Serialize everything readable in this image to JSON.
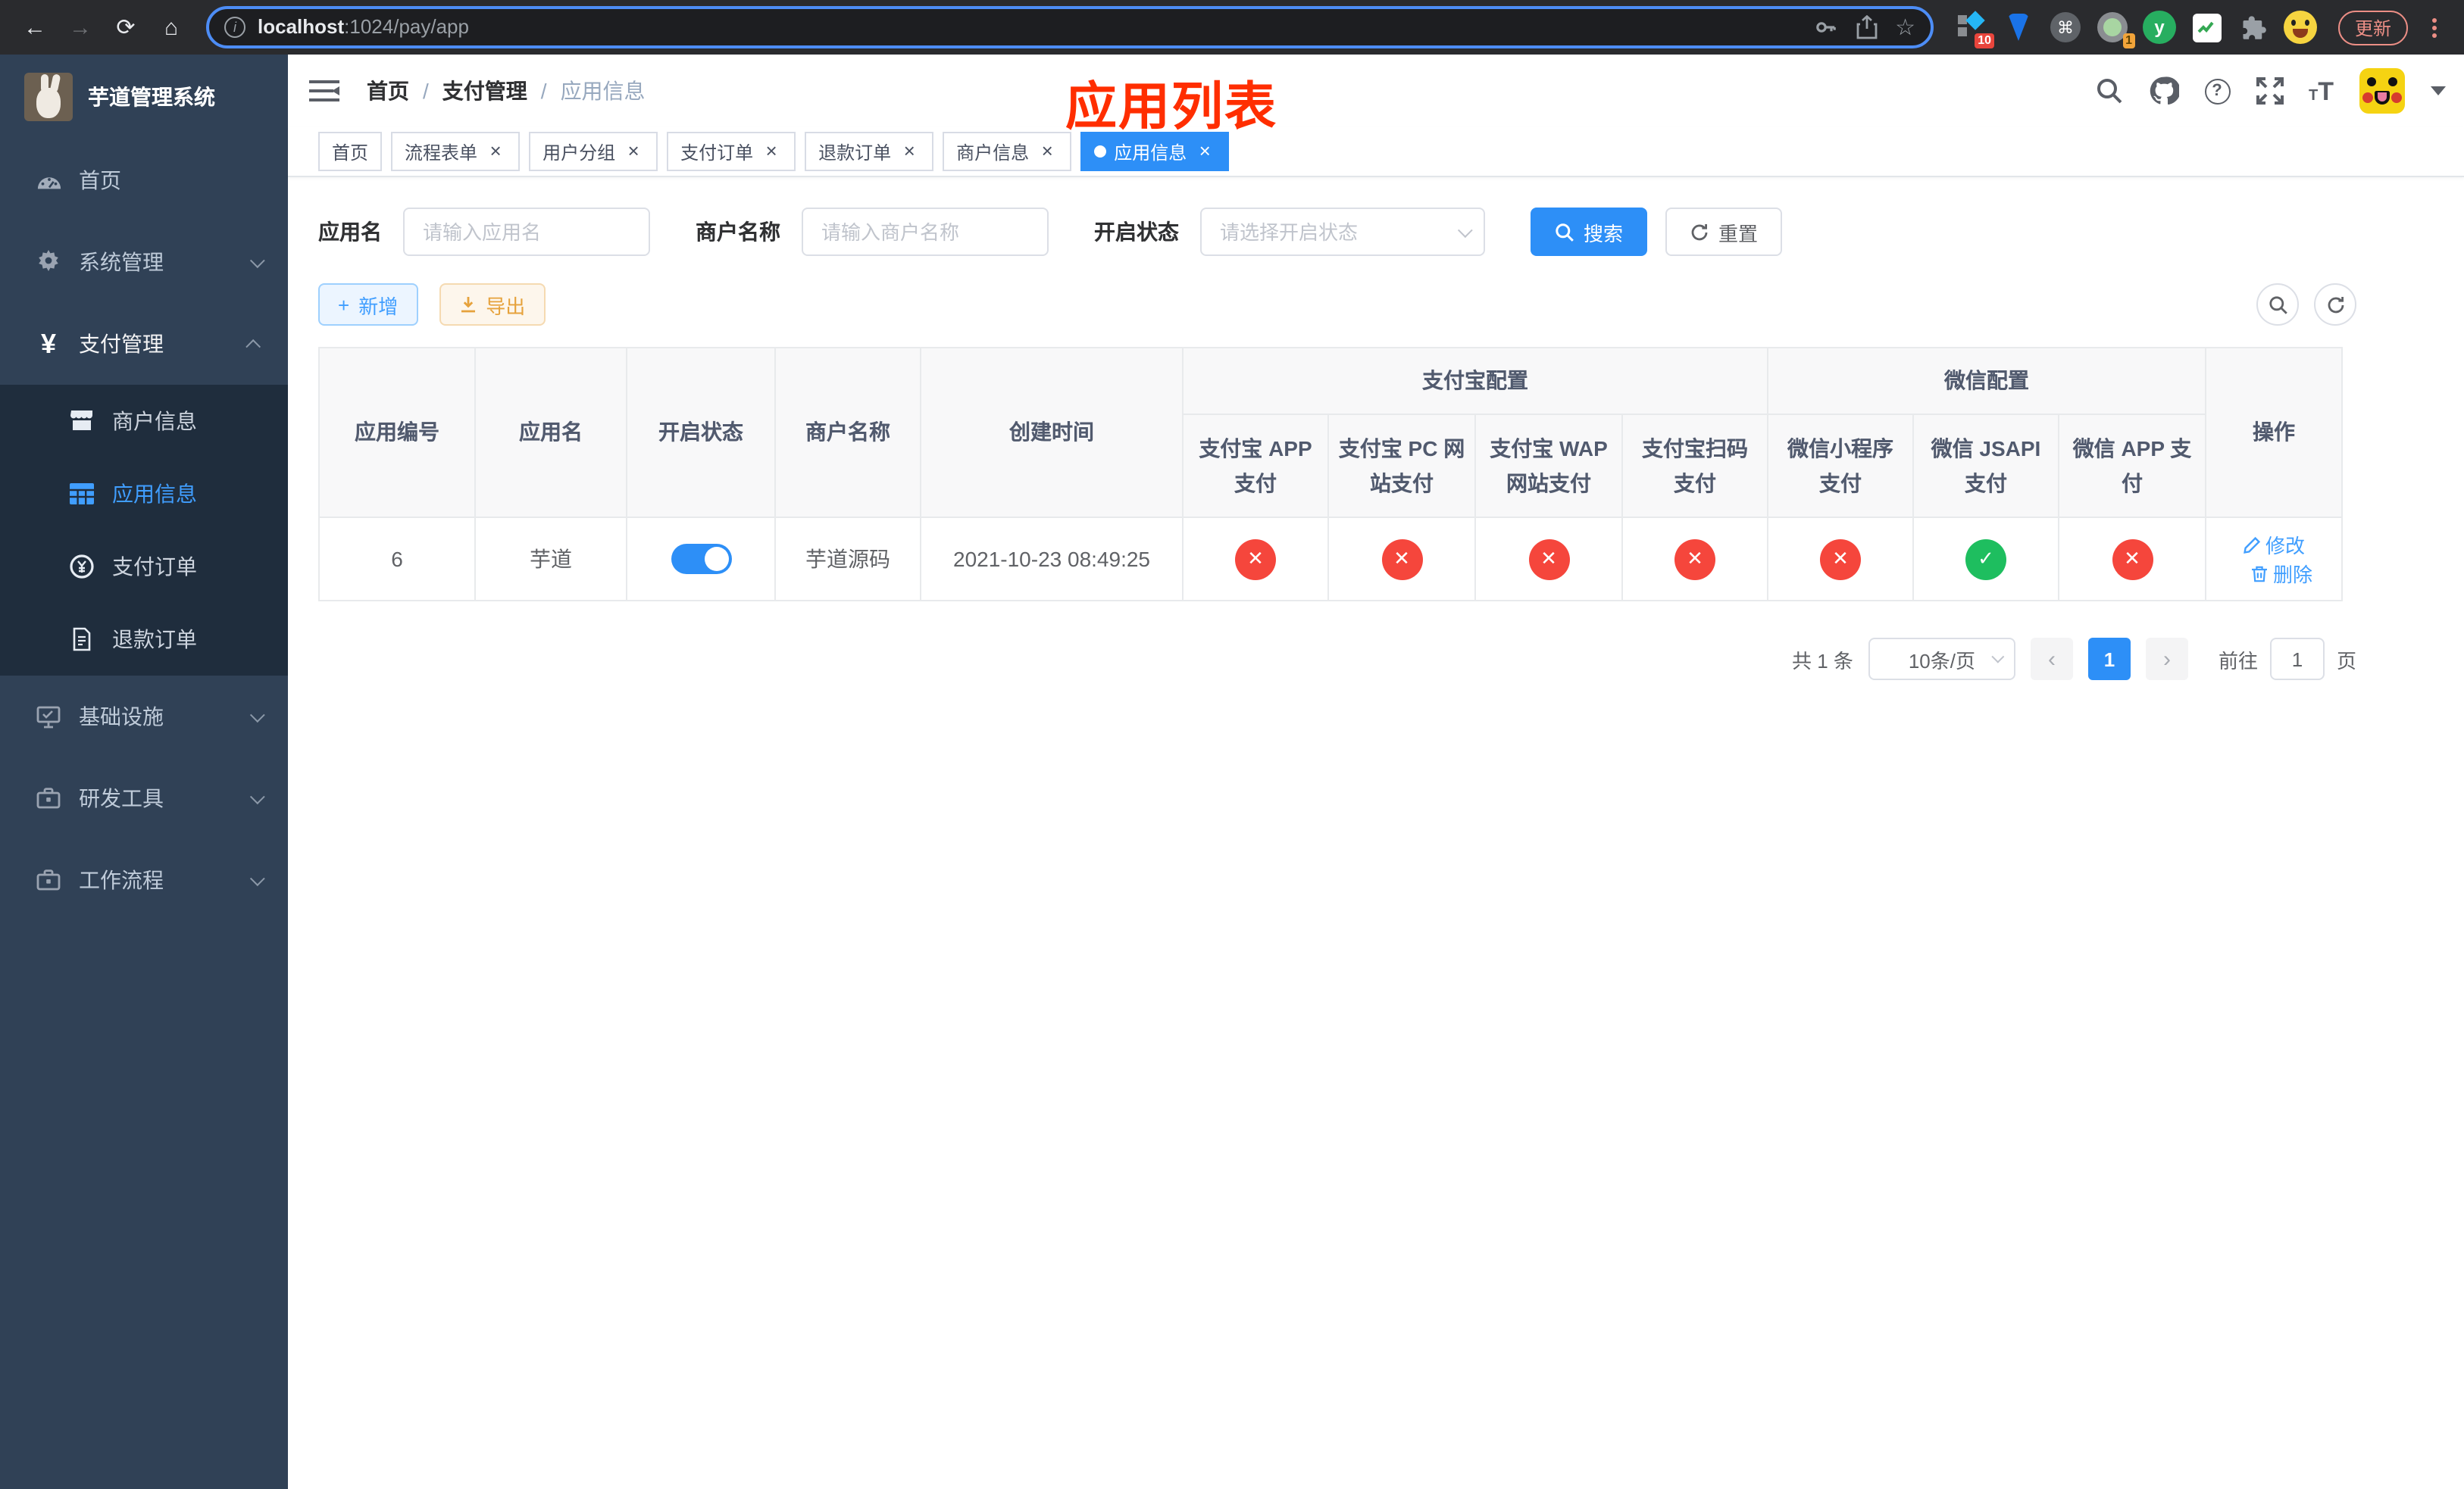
{
  "browser": {
    "url_host": "localhost",
    "url_rest": ":1024/pay/app",
    "update_label": "更新",
    "ext_badge_blue_diamond": "10",
    "ext_badge_profile": "1",
    "ext_letter": "y"
  },
  "glyphs": {
    "back": "←",
    "forward": "→",
    "reload": "⟳",
    "home": "⌂",
    "star": "☆",
    "command": "⌘",
    "info": "i",
    "question": "?",
    "yuan": "¥",
    "font_small": "T",
    "font_big": "T",
    "check": "✓",
    "cross": "✕",
    "close": "×",
    "prev": "‹",
    "next": "›",
    "plus": "+"
  },
  "overlay_title": "应用列表",
  "sidebar": {
    "title": "芋道管理系统",
    "home": "首页",
    "system": "系统管理",
    "payment": "支付管理",
    "sub_merchant": "商户信息",
    "sub_app": "应用信息",
    "sub_pay_order": "支付订单",
    "sub_refund_order": "退款订单",
    "infra": "基础设施",
    "dev_tools": "研发工具",
    "workflow": "工作流程"
  },
  "breadcrumb": {
    "items": [
      "首页",
      "支付管理",
      "应用信息"
    ],
    "sep": "/"
  },
  "tabs": [
    {
      "label": "首页",
      "closable": false,
      "active": false
    },
    {
      "label": "流程表单",
      "closable": true,
      "active": false
    },
    {
      "label": "用户分组",
      "closable": true,
      "active": false
    },
    {
      "label": "支付订单",
      "closable": true,
      "active": false
    },
    {
      "label": "退款订单",
      "closable": true,
      "active": false
    },
    {
      "label": "商户信息",
      "closable": true,
      "active": false
    },
    {
      "label": "应用信息",
      "closable": true,
      "active": true
    }
  ],
  "filters": {
    "app_name_label": "应用名",
    "app_name_placeholder": "请输入应用名",
    "merchant_label": "商户名称",
    "merchant_placeholder": "请输入商户名称",
    "status_label": "开启状态",
    "status_placeholder": "请选择开启状态",
    "search_label": "搜索",
    "reset_label": "重置"
  },
  "toolbar": {
    "add_label": "新增",
    "export_label": "导出"
  },
  "table": {
    "headers": {
      "app_id": "应用编号",
      "app_name": "应用名",
      "status": "开启状态",
      "merchant": "商户名称",
      "create_time": "创建时间",
      "alipay_group": "支付宝配置",
      "wechat_group": "微信配置",
      "alipay_app": "支付宝 APP 支付",
      "alipay_pc": "支付宝 PC 网站支付",
      "alipay_wap": "支付宝 WAP 网站支付",
      "alipay_qr": "支付宝扫码支付",
      "wx_mini": "微信小程序支付",
      "wx_jsapi": "微信 JSAPI 支付",
      "wx_app": "微信 APP 支付",
      "actions": "操作"
    },
    "row": {
      "id": "6",
      "name": "芋道",
      "enabled": true,
      "merchant": "芋道源码",
      "create_time": "2021-10-23 08:49:25",
      "channels": {
        "alipay_app": false,
        "alipay_pc": false,
        "alipay_wap": false,
        "alipay_qr": false,
        "wx_mini": false,
        "wx_jsapi": true,
        "wx_app": false
      },
      "edit_label": "修改",
      "delete_label": "删除"
    }
  },
  "pagination": {
    "total": "共 1 条",
    "page_size": "10条/页",
    "current_page": "1",
    "goto_label": "前往",
    "goto_value": "1",
    "page_suffix": "页"
  },
  "colors": {
    "accent": "#409eff",
    "tag_active": "#2d8ff7",
    "sidebar_bg": "#304156",
    "submenu_bg": "#1f2d3d",
    "danger": "#f5463c",
    "success": "#1ebe5f",
    "warning": "#e6a23c",
    "overlay_red": "#ff2e00",
    "header_bg": "#f8f8f9"
  }
}
